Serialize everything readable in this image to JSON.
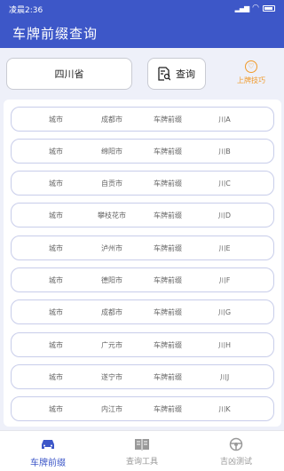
{
  "status": {
    "time": "凌晨2:36",
    "battery": ""
  },
  "app": {
    "title": "车牌前缀查询"
  },
  "search": {
    "province": "四川省",
    "query_label": "查询",
    "tips_label": "上牌技巧"
  },
  "colors": {
    "primary": "#3d57c8",
    "accent": "#f09a2a",
    "row_border": "#c8cdea"
  },
  "rows": [
    {
      "city_label": "城市",
      "city": "成都市",
      "prefix_label": "车牌前缀",
      "prefix": "川A"
    },
    {
      "city_label": "城市",
      "city": "绵阳市",
      "prefix_label": "车牌前缀",
      "prefix": "川B"
    },
    {
      "city_label": "城市",
      "city": "自贡市",
      "prefix_label": "车牌前缀",
      "prefix": "川C"
    },
    {
      "city_label": "城市",
      "city": "攀枝花市",
      "prefix_label": "车牌前缀",
      "prefix": "川D"
    },
    {
      "city_label": "城市",
      "city": "泸州市",
      "prefix_label": "车牌前缀",
      "prefix": "川E"
    },
    {
      "city_label": "城市",
      "city": "德阳市",
      "prefix_label": "车牌前缀",
      "prefix": "川F"
    },
    {
      "city_label": "城市",
      "city": "成都市",
      "prefix_label": "车牌前缀",
      "prefix": "川G"
    },
    {
      "city_label": "城市",
      "city": "广元市",
      "prefix_label": "车牌前缀",
      "prefix": "川H"
    },
    {
      "city_label": "城市",
      "city": "遂宁市",
      "prefix_label": "车牌前缀",
      "prefix": "川J"
    },
    {
      "city_label": "城市",
      "city": "内江市",
      "prefix_label": "车牌前缀",
      "prefix": "川K"
    }
  ],
  "nav": {
    "items": [
      {
        "label": "车牌前缀",
        "icon": "car-icon",
        "active": true
      },
      {
        "label": "查询工具",
        "icon": "book-icon",
        "active": false
      },
      {
        "label": "吉凶测试",
        "icon": "steering-wheel-icon",
        "active": false
      }
    ]
  }
}
